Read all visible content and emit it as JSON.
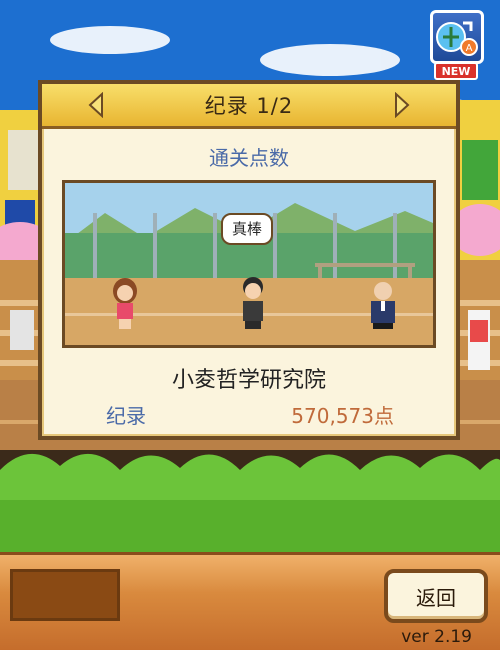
{
  "dialog": {
    "title": "纪录 1/2",
    "subtitle": "通关点数",
    "speech": "真棒",
    "school_name": "小夌哲学研究院",
    "record_label": "纪录",
    "record_value": "570,573点"
  },
  "bottom_bar": {
    "back_label": "返回",
    "version": "ver 2.19"
  },
  "top_icon": {
    "badge": "NEW",
    "icon": "refresh-news-icon"
  },
  "colors": {
    "header_yellow": "#f3c84a",
    "dialog_bg": "#fbf4dd",
    "label_blue": "#4a6aa8",
    "value_orange": "#c06a3a",
    "bottom_orange": "#d98a3e"
  }
}
